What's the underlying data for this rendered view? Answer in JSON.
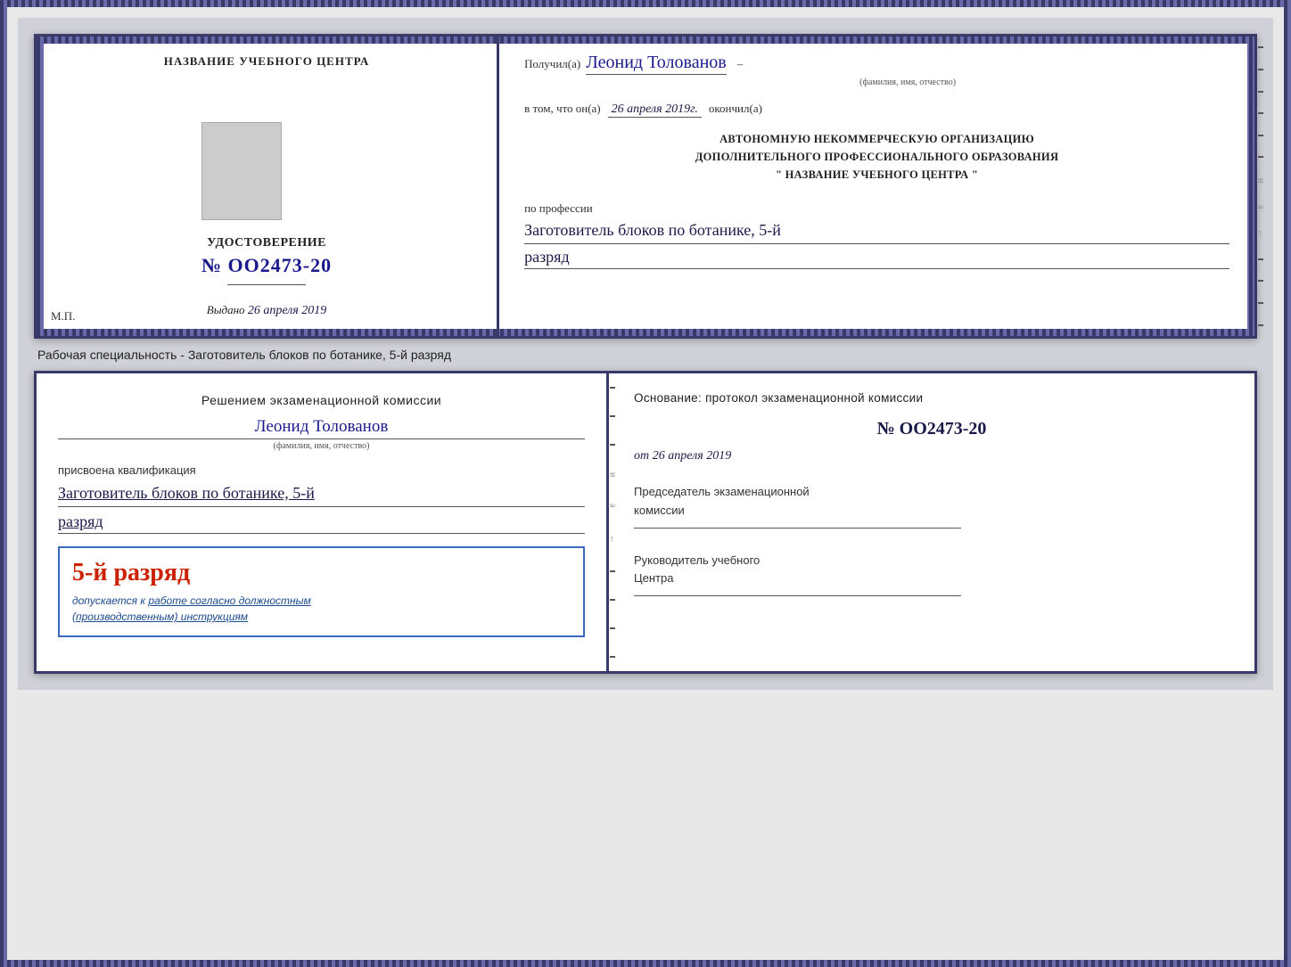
{
  "top_cert": {
    "left": {
      "title": "НАЗВАНИЕ УЧЕБНОГО ЦЕНТРА",
      "udost_title": "УДОСТОВЕРЕНИЕ",
      "number": "№ OO2473-20",
      "vydano_label": "Выдано",
      "vydano_date": "26 апреля 2019",
      "mp_label": "М.П."
    },
    "right": {
      "poluchil_label": "Получил(а)",
      "person_name": "Леонид Толованов",
      "fio_sub": "(фамилия, имя, отчество)",
      "dash": "–",
      "vtom_label": "в том, что он(а)",
      "vtom_date": "26 апреля 2019г.",
      "okonchil": "окончил(а)",
      "org_line1": "АВТОНОМНУЮ НЕКОММЕРЧЕСКУЮ ОРГАНИЗАЦИЮ",
      "org_line2": "ДОПОЛНИТЕЛЬНОГО ПРОФЕССИОНАЛЬНОГО ОБРАЗОВАНИЯ",
      "org_line3": "\"  НАЗВАНИЕ УЧЕБНОГО ЦЕНТРА  \"",
      "po_professii": "по профессии",
      "profession": "Заготовитель блоков по ботанике, 5-й",
      "razryad": "разряд"
    }
  },
  "speciality_label": "Рабочая специальность - Заготовитель блоков по ботанике, 5-й разряд",
  "bottom_cert": {
    "left": {
      "decision_title": "Решением экзаменационной комиссии",
      "person_name": "Леонид Толованов",
      "fio_sub": "(фамилия, имя, отчество)",
      "prisvоena_label": "присвоена квалификация",
      "qualification": "Заготовитель блоков по ботанике, 5-й",
      "razryad": "разряд",
      "stamp_grade": "5-й разряд",
      "stamp_text_prefix": "допускается к",
      "stamp_underline": "работе согласно должностным",
      "stamp_italic": "(производственным) инструкциям"
    },
    "right": {
      "osnovanie_label": "Основание: протокол экзаменационной комиссии",
      "number": "№  OO2473-20",
      "ot_label": "от",
      "ot_date": "26 апреля 2019",
      "chairman_line1": "Председатель экзаменационной",
      "chairman_line2": "комиссии",
      "rukovoditel_line1": "Руководитель учебного",
      "rukovoditel_line2": "Центра"
    }
  }
}
